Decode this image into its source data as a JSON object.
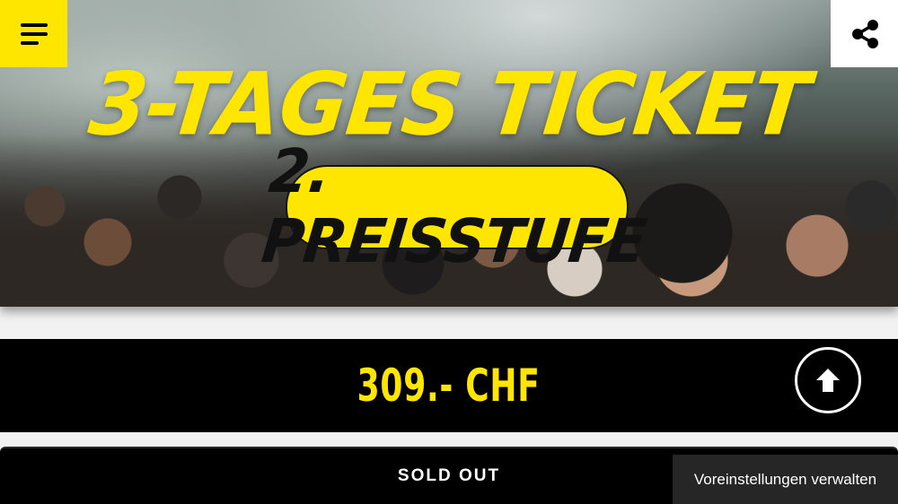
{
  "hero": {
    "title": "3-TAGES TICKET",
    "badge": "2. PREISSTUFE"
  },
  "header": {
    "menu_icon": "hamburger-menu-icon",
    "share_icon": "share-icon"
  },
  "price": {
    "amount": "309.- CHF"
  },
  "actions": {
    "scroll_top_icon": "arrow-up-icon",
    "sold_out_label": "SOLD OUT",
    "cookie_settings_label": "Voreinstellungen verwalten"
  },
  "colors": {
    "accent": "#ffe600",
    "dark": "#000000",
    "cookie_bg": "#262626"
  }
}
